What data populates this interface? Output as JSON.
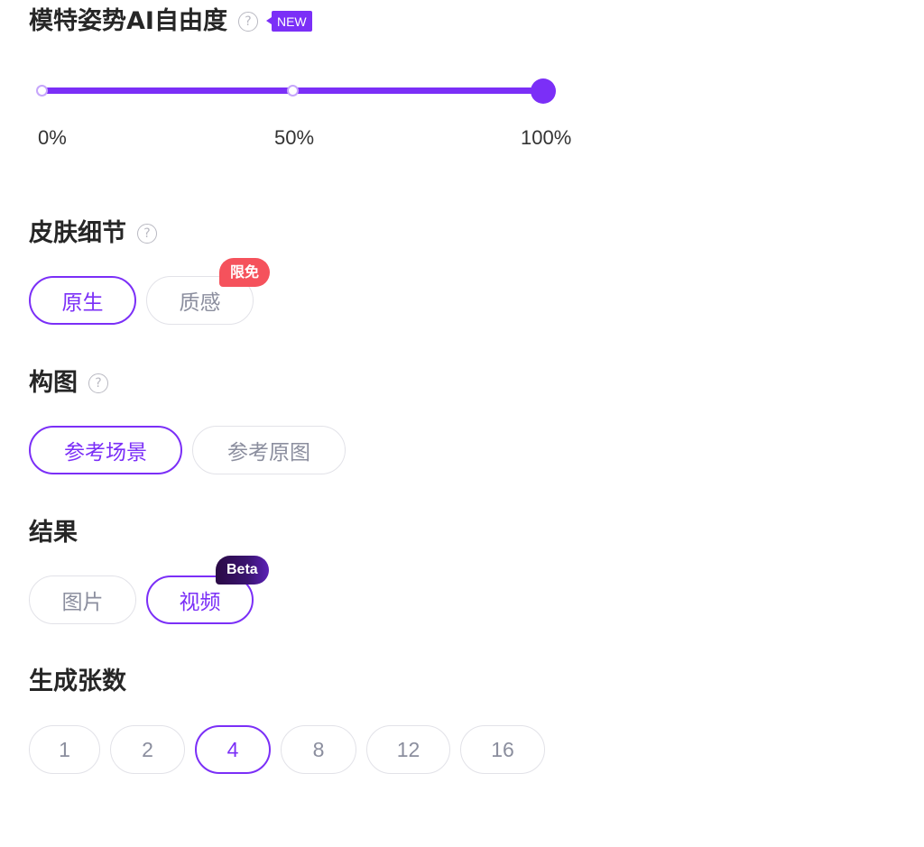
{
  "pose_freedom": {
    "title": "模特姿势AI自由度",
    "help_icon": "?",
    "new_badge": "NEW",
    "slider": {
      "value_percent": 100,
      "stops": [
        "0%",
        "50%",
        "100%"
      ]
    }
  },
  "skin_detail": {
    "title": "皮肤细节",
    "help_icon": "?",
    "options": [
      "原生",
      "质感"
    ],
    "selected": "原生",
    "badge": "限免"
  },
  "composition": {
    "title": "构图",
    "help_icon": "?",
    "options": [
      "参考场景",
      "参考原图"
    ],
    "selected": "参考场景"
  },
  "result": {
    "title": "结果",
    "options": [
      "图片",
      "视频"
    ],
    "selected": "视频",
    "badge": "Beta"
  },
  "count": {
    "title": "生成张数",
    "options": [
      "1",
      "2",
      "4",
      "8",
      "12",
      "16"
    ],
    "selected": "4"
  },
  "colors": {
    "accent": "#7b2ff7",
    "free_badge": "#f5525c",
    "beta_badge": "#2a0a45"
  }
}
